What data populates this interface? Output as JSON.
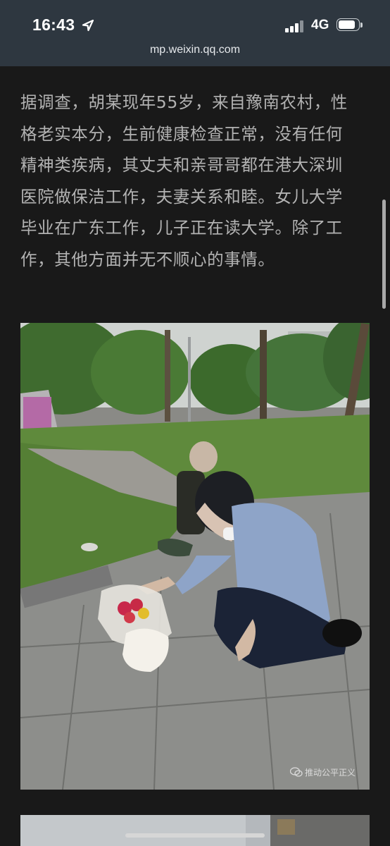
{
  "status_bar": {
    "time": "16:43",
    "network": "4G",
    "location_icon": "location-arrow-icon",
    "signal_icon": "cellular-signal-icon",
    "battery_icon": "battery-icon",
    "battery_level": 0.85
  },
  "browser": {
    "url": "mp.weixin.qq.com"
  },
  "article": {
    "paragraph": "据调查，胡某现年55岁，来自豫南农村，性格老实本分，生前健康检查正常，没有任何精神类疾病，其丈夫和亲哥哥都在港大深圳医院做保洁工作，夫妻关系和睦。女儿大学毕业在广东工作，儿子正在读大学。除了工作，其他方面并无不顺心的事情。",
    "image_watermark": "推动公平正义",
    "watermark_icon": "wechat-icon"
  },
  "colors": {
    "background": "#191919",
    "status_bar": "#2e3740",
    "text": "#b3b3b3"
  }
}
